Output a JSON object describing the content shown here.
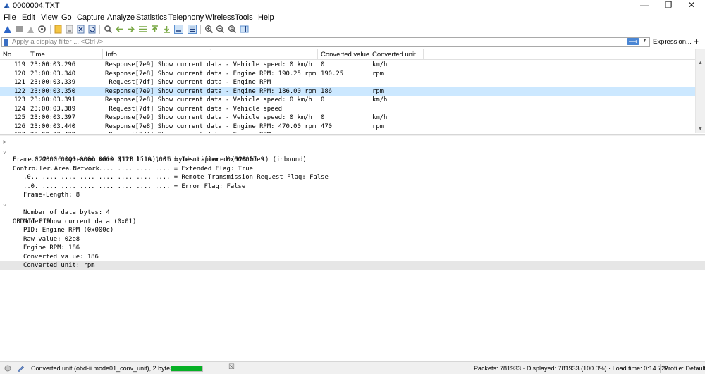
{
  "window": {
    "title": "0000004.TXT",
    "minimize_glyph": "—",
    "restore_glyph": "❐",
    "close_glyph": "✕"
  },
  "menu": [
    "File",
    "Edit",
    "View",
    "Go",
    "Capture",
    "Analyze",
    "Statistics",
    "Telephony",
    "Wireless",
    "Tools",
    "Help"
  ],
  "toolbar_icons": [
    "shark-fin-start-icon",
    "stop-capture-icon",
    "restart-capture-icon",
    "capture-options-icon",
    "open-file-icon",
    "save-file-icon",
    "close-file-icon",
    "reload-file-icon",
    "find-packet-icon",
    "go-back-icon",
    "go-forward-icon",
    "go-to-packet-icon",
    "go-first-icon",
    "go-last-icon",
    "autoscroll-icon",
    "colorize-icon",
    "zoom-in-icon",
    "zoom-out-icon",
    "zoom-normal-icon",
    "resize-columns-icon"
  ],
  "filter": {
    "placeholder": "Apply a display filter ... <Ctrl-/>",
    "expression_label": "Expression...",
    "add_label": "+",
    "apply_glyph": "⟹"
  },
  "packet_list": {
    "columns": [
      "No.",
      "Time",
      "Info",
      "Converted value",
      "Converted unit"
    ],
    "sort_glyph": "^",
    "rows": [
      {
        "no": "119",
        "time": "23:00:03.296",
        "info": "Response[7e9] Show current data - Vehicle speed: 0 km/h",
        "value": "0",
        "unit": "km/h"
      },
      {
        "no": "120",
        "time": "23:00:03.340",
        "info": "Response[7e8] Show current data - Engine RPM: 190.25 rpm",
        "value": "190.25",
        "unit": "rpm"
      },
      {
        "no": "121",
        "time": "23:00:03.339",
        "info": " Request[7df] Show current data - Engine RPM",
        "value": "",
        "unit": ""
      },
      {
        "no": "122",
        "time": "23:00:03.350",
        "info": "Response[7e9] Show current data - Engine RPM: 186.00 rpm",
        "value": "186",
        "unit": "rpm"
      },
      {
        "no": "123",
        "time": "23:00:03.391",
        "info": "Response[7e8] Show current data - Vehicle speed: 0 km/h",
        "value": "0",
        "unit": "km/h"
      },
      {
        "no": "124",
        "time": "23:00:03.389",
        "info": " Request[7df] Show current data - Vehicle speed",
        "value": "",
        "unit": ""
      },
      {
        "no": "125",
        "time": "23:00:03.397",
        "info": "Response[7e9] Show current data - Vehicle speed: 0 km/h",
        "value": "0",
        "unit": "km/h"
      },
      {
        "no": "126",
        "time": "23:00:03.440",
        "info": "Response[7e8] Show current data - Engine RPM: 470.00 rpm",
        "value": "470",
        "unit": "rpm"
      },
      {
        "no": "127",
        "time": "23:00:03.439",
        "info": " Request[7df] Show current data - Engine RPM",
        "value": "",
        "unit": ""
      }
    ],
    "selected_index": 3
  },
  "details": {
    "frame": "Frame 122: 16 bytes on wire (128 bits), 16 bytes captured (128 bits) (inbound)",
    "can_title": "Controller Area Network",
    "can_fields": [
      "...0 0000 0000 0000 0000 0111 1110 1001 = Identifier: 0x000007e9",
      "1... .... .... .... .... .... .... .... = Extended Flag: True",
      ".0.. .... .... .... .... .... .... .... = Remote Transmission Request Flag: False",
      "..0. .... .... .... .... .... .... .... = Error Flag: False",
      "Frame-Length: 8"
    ],
    "obd_title": "OBD-II PID",
    "obd_fields": [
      "Number of data bytes: 4",
      "Mode: Show current data (0x01)",
      "PID: Engine RPM (0x000c)",
      "Raw value: 02e8",
      "Engine RPM: 186",
      "Converted value: 186",
      "Converted unit: rpm"
    ],
    "collapsed_glyph": ">",
    "expanded_glyph": "⌄"
  },
  "status": {
    "field_info": "Converted unit (obd-ii.mode01_conv_unit), 2 bytes",
    "stats": "Packets: 781933 · Displayed: 781933 (100.0%) · Load time: 0:14.727",
    "profile": "Profile: Default",
    "progress_fraction": 1.0
  },
  "colors": {
    "selected_row": "#cce8ff",
    "highlight_row": "#e6e6e6",
    "progress": "#06b025",
    "accent": "#3a6fc4"
  }
}
